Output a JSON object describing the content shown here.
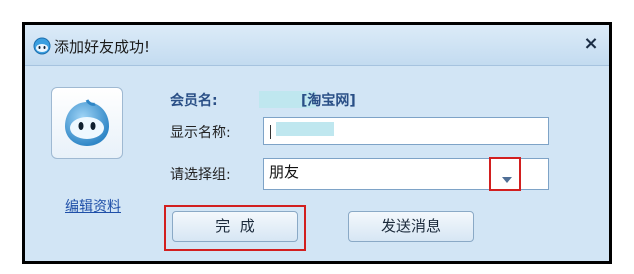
{
  "dialog": {
    "title": "添加好友成功!",
    "close_label": "×"
  },
  "profile": {
    "edit_link": "编辑资料"
  },
  "form": {
    "member_label": "会员名:",
    "member_site": "[淘宝网]",
    "display_name_label": "显示名称:",
    "display_name_value": "",
    "group_label": "请选择组:",
    "group_value": "朋友"
  },
  "buttons": {
    "done": "完  成",
    "send": "发送消息"
  },
  "colors": {
    "highlight": "#d21f1f",
    "dialog_bg": "#d2e5f5",
    "accent_text": "#2a4f86"
  },
  "icons": [
    "app-logo-icon",
    "avatar-icon",
    "close-icon",
    "chevron-down-icon"
  ]
}
